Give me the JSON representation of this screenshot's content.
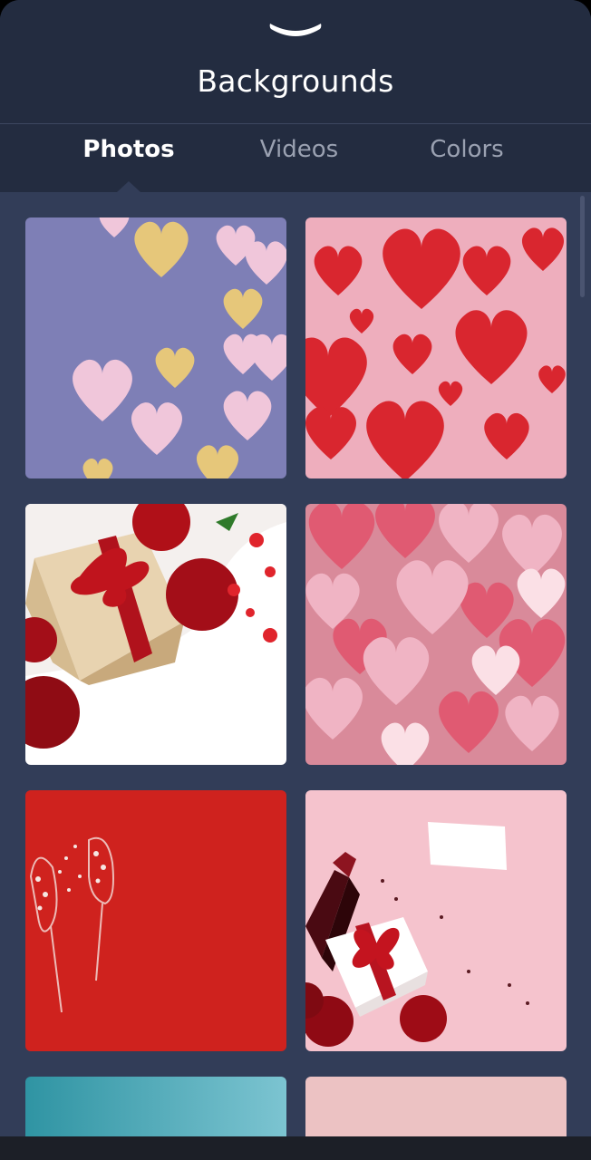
{
  "header": {
    "title": "Backgrounds",
    "handle_icon": "chevron-down-icon"
  },
  "tabs": [
    {
      "label": "Photos",
      "active": true
    },
    {
      "label": "Videos",
      "active": false
    },
    {
      "label": "Colors",
      "active": false
    }
  ],
  "colors": {
    "header_bg": "#232c40",
    "content_bg": "#323d58",
    "active_tab": "#ffffff",
    "inactive_tab": "#9aa1b1"
  }
}
